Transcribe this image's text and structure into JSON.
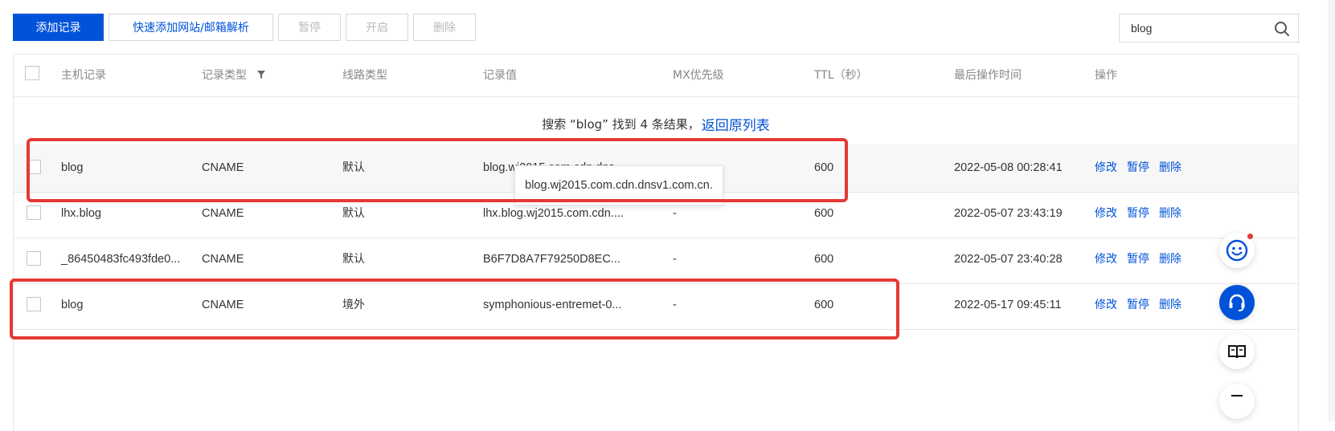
{
  "toolbar": {
    "add_record": "添加记录",
    "quick_add": "快速添加网站/邮箱解析",
    "pause": "暂停",
    "enable": "开启",
    "delete": "删除"
  },
  "search": {
    "value": "blog",
    "icon": "search-icon"
  },
  "table": {
    "headers": {
      "host": "主机记录",
      "type": "记录类型",
      "line": "线路类型",
      "value": "记录值",
      "mx": "MX优先级",
      "ttl": "TTL（秒）",
      "time": "最后操作时间",
      "ops": "操作"
    },
    "notice": {
      "text": "搜索 “blog” 找到 4 条结果，",
      "link": "返回原列表"
    },
    "rows": [
      {
        "host": "blog",
        "type": "CNAME",
        "line": "默认",
        "value": "blog.wj2015.com.cdn.dns...",
        "mx": "-",
        "ttl": "600",
        "time": "2022-05-08 00:28:41",
        "edit": "修改",
        "pause": "暂停",
        "delete": "删除"
      },
      {
        "host": "lhx.blog",
        "type": "CNAME",
        "line": "默认",
        "value": "lhx.blog.wj2015.com.cdn....",
        "mx": "-",
        "ttl": "600",
        "time": "2022-05-07 23:43:19",
        "edit": "修改",
        "pause": "暂停",
        "delete": "删除"
      },
      {
        "host": "_86450483fc493fde0...",
        "type": "CNAME",
        "line": "默认",
        "value": "B6F7D8A7F79250D8EC...",
        "mx": "-",
        "ttl": "600",
        "time": "2022-05-07 23:40:28",
        "edit": "修改",
        "pause": "暂停",
        "delete": "删除"
      },
      {
        "host": "blog",
        "type": "CNAME",
        "line": "境外",
        "value": "symphonious-entremet-0...",
        "mx": "-",
        "ttl": "600",
        "time": "2022-05-17 09:45:11",
        "edit": "修改",
        "pause": "暂停",
        "delete": "删除"
      }
    ]
  },
  "tooltip": {
    "text": "blog.wj2015.com.cdn.dnsv1.com.cn."
  },
  "colors": {
    "primary": "#0052d9",
    "highlight": "#e53935"
  }
}
